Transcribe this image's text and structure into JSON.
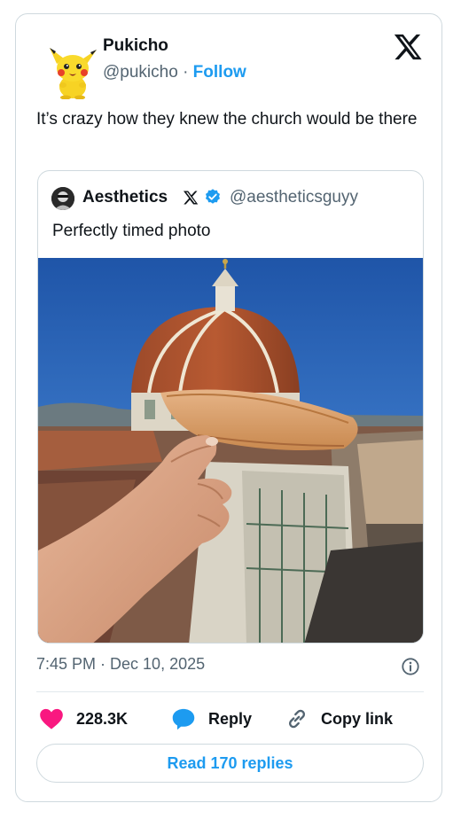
{
  "tweet": {
    "author_name": "Pukicho",
    "author_handle": "@pukicho",
    "separator": "·",
    "follow_label": "Follow",
    "text": "It’s crazy how they knew the church would be there",
    "timestamp": "7:45 PM · Dec 10, 2025"
  },
  "quote": {
    "author_name": "Aesthetics",
    "author_handle": "@aestheticsguyy",
    "text": "Perfectly timed photo"
  },
  "actions": {
    "like_count": "228.3K",
    "reply_label": "Reply",
    "copy_label": "Copy link",
    "read_replies_label": "Read 170 replies"
  },
  "colors": {
    "accent": "#1d9bf0",
    "like": "#f91880",
    "text": "#0f1419",
    "secondary": "#536471"
  },
  "icons": [
    "pikachu-avatar",
    "x-logo-icon",
    "x-badge-icon",
    "verified-badge-icon",
    "info-icon",
    "heart-icon",
    "reply-bubble-icon",
    "link-icon"
  ]
}
